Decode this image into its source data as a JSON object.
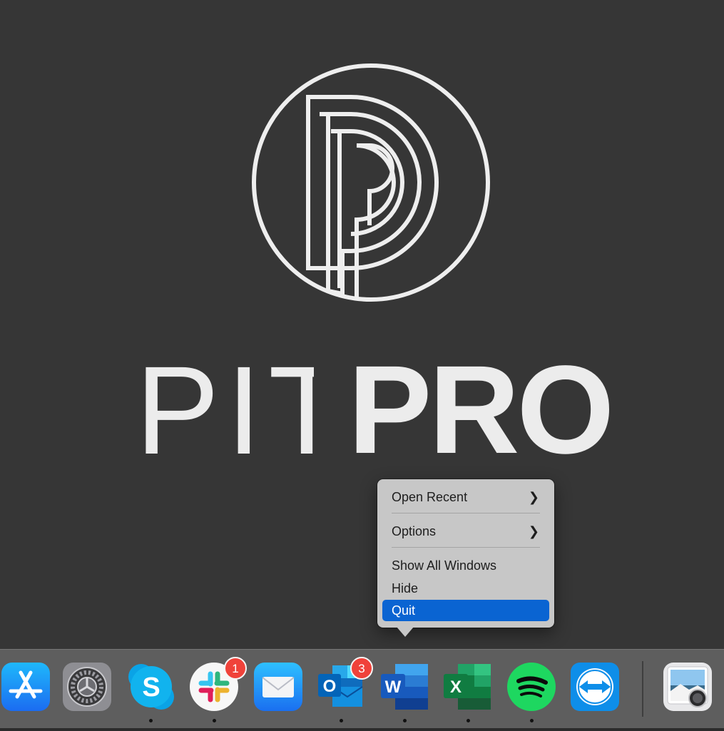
{
  "brand": {
    "name_light": "PIT",
    "name_bold": "PRO"
  },
  "context_menu": {
    "items": [
      {
        "label": "Open Recent",
        "has_submenu": true
      },
      {
        "label": "Options",
        "has_submenu": true
      },
      {
        "label": "Show All Windows",
        "has_submenu": false
      },
      {
        "label": "Hide",
        "has_submenu": false
      },
      {
        "label": "Quit",
        "has_submenu": false,
        "selected": true
      }
    ],
    "submenu_icon": "chevron-right-icon"
  },
  "dock": {
    "apps": [
      {
        "name": "App Store",
        "icon": "app-store-icon",
        "running": false
      },
      {
        "name": "System Preferences",
        "icon": "system-preferences-icon",
        "running": false
      },
      {
        "name": "Skype",
        "icon": "skype-icon",
        "running": true
      },
      {
        "name": "Slack",
        "icon": "slack-icon",
        "running": true,
        "badge": "1"
      },
      {
        "name": "Mail",
        "icon": "mail-icon",
        "running": false
      },
      {
        "name": "Outlook",
        "icon": "outlook-icon",
        "running": true,
        "badge": "3"
      },
      {
        "name": "Word",
        "icon": "word-icon",
        "running": true
      },
      {
        "name": "Excel",
        "icon": "excel-icon",
        "running": true
      },
      {
        "name": "Spotify",
        "icon": "spotify-icon",
        "running": true
      },
      {
        "name": "TeamViewer",
        "icon": "teamviewer-icon",
        "running": false
      },
      {
        "name": "Preview",
        "icon": "preview-icon",
        "running": false
      }
    ]
  },
  "colors": {
    "desktop": "#363636",
    "menu_background": "#c7c7c7",
    "menu_selected": "#0a64d2",
    "badge": "#f0423a"
  }
}
